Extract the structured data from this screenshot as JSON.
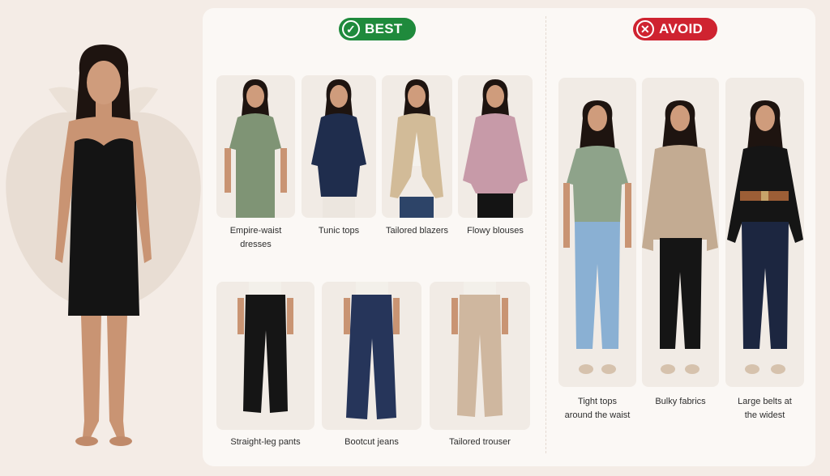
{
  "best": {
    "badge_label": "BEST",
    "tops": [
      {
        "label": "Empire-waist\ndresses",
        "color": "#7f9475"
      },
      {
        "label": "Tunic tops",
        "color": "#1f2d4d"
      },
      {
        "label": "Tailored blazers",
        "color": "#d2bb98"
      },
      {
        "label": "Flowy blouses",
        "color": "#c79aa8"
      }
    ],
    "bottoms": [
      {
        "label": "Straight-leg pants",
        "color": "#151515"
      },
      {
        "label": "Bootcut jeans",
        "color": "#26355a"
      },
      {
        "label": "Tailored trouser",
        "color": "#cfb79f"
      }
    ]
  },
  "avoid": {
    "badge_label": "AVOID",
    "items": [
      {
        "label": "Tight tops\naround the waist",
        "top_color": "#8ea38a",
        "bottom_color": "#8ab0d3"
      },
      {
        "label": "Bulky fabrics",
        "top_color": "#c3ab92",
        "bottom_color": "#151515"
      },
      {
        "label": "Large belts at\nthe widest",
        "top_color": "#151515",
        "bottom_color": "#1c2640"
      }
    ]
  },
  "colors": {
    "best_green": "#1f8a3c",
    "avoid_red": "#cf2330",
    "background": "#f4ece6",
    "apple_shape": "#e8ddd3",
    "skin": "#c99473",
    "hair": "#1e1410"
  },
  "icons": {
    "best": "checkmark-icon",
    "avoid": "x-mark-icon"
  }
}
